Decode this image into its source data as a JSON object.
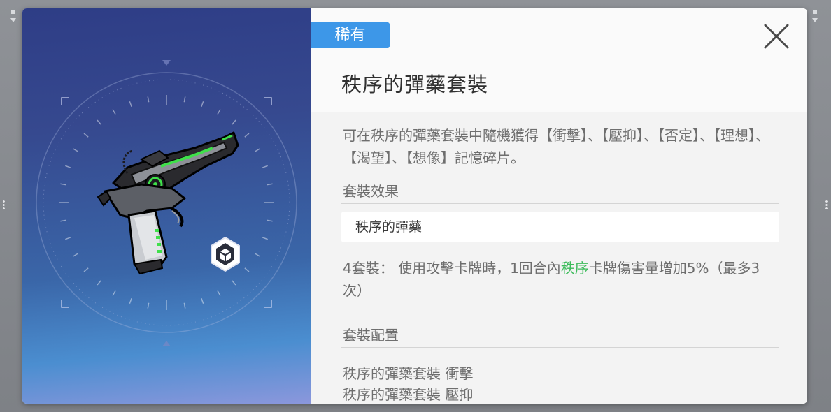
{
  "item": {
    "rarity": "稀有",
    "name": "秩序的彈藥套裝",
    "description": "可在秩序的彈藥套裝中隨機獲得【衝擊】、【壓抑】、【否定】、【理想】、【渴望】、【想像】記憶碎片。"
  },
  "set_effect": {
    "label": "套裝效果",
    "name": "秩序的彈藥",
    "prefix": "4套裝： 使用攻擊卡牌時，1回合內",
    "highlight": "秩序",
    "suffix": "卡牌傷害量增加5%（最多3次）"
  },
  "set_config": {
    "label": "套裝配置",
    "items": [
      "秩序的彈藥套裝 衝擊",
      "秩序的彈藥套裝 壓抑"
    ]
  },
  "colors": {
    "rarity_badge": "#3d97e8",
    "highlight_green": "#3dbb5b"
  },
  "icons": {
    "close": "close-x-icon",
    "item_art": "pistol-art",
    "type_badge": "hexagon-cube-icon"
  }
}
